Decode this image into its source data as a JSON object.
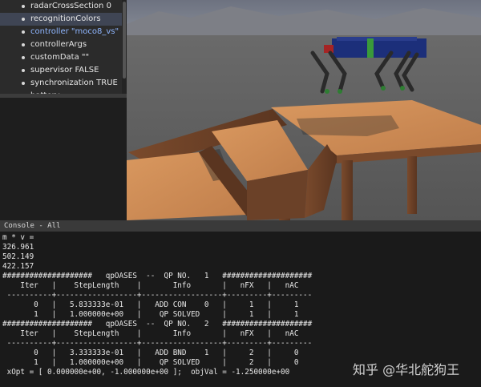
{
  "scene_tree": {
    "items": [
      {
        "label": "radarCrossSection 0",
        "state": "normal"
      },
      {
        "label": "recognitionColors",
        "state": "selected"
      },
      {
        "label": "controller \"moco8_vs\"",
        "state": "link"
      },
      {
        "label": "controllerArgs",
        "state": "normal"
      },
      {
        "label": "customData \"\"",
        "state": "normal"
      },
      {
        "label": "supervisor FALSE",
        "state": "normal"
      },
      {
        "label": "synchronization TRUE",
        "state": "normal"
      },
      {
        "label": "battery",
        "state": "normal"
      }
    ]
  },
  "console": {
    "title": "Console - All",
    "lines": [
      "m * v =",
      "326.961",
      "502.149",
      "422.157",
      "####################   qpOASES  --  QP NO.   1   ####################",
      "    Iter   |    StepLength    |       Info       |   nFX   |   nAC",
      " ----------+------------------+------------------+---------+---------",
      "       0   |   5.833333e-01   |   ADD CON    0   |     1   |     1",
      "       1   |   1.000000e+00   |    QP SOLVED     |     1   |     1",
      "####################   qpOASES  --  QP NO.   2   ####################",
      "    Iter   |    StepLength    |       Info       |   nFX   |   nAC",
      " ----------+------------------+------------------+---------+---------",
      "       0   |   3.333333e-01   |   ADD BND    1   |     2   |     0",
      "       1   |   1.000000e+00   |    QP SOLVED     |     2   |     0",
      " xOpt = [ 0.000000e+00, -1.000000e+00 ];  objVal = -1.250000e+00"
    ]
  },
  "watermark": "知乎 @华北舵狗王",
  "colors": {
    "tree_bg": "#2b2b2b",
    "tree_selected": "#3f4554",
    "link_text": "#8fb6ff",
    "console_bg": "#1a1a1a",
    "wood": "#c98a55",
    "wood_dark": "#6b4128",
    "robot_body": "#1c2f7a",
    "robot_leg": "#2a2a2a",
    "floor": "#5e5e5e"
  },
  "icons": [
    "tree-bullet-icon"
  ]
}
